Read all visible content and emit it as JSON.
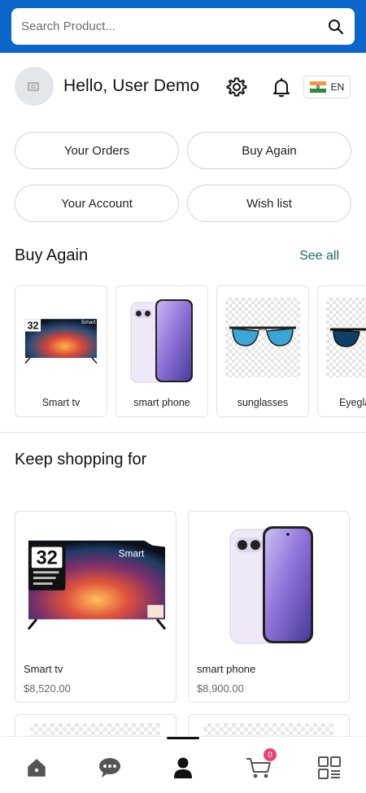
{
  "search": {
    "placeholder": "Search Product..."
  },
  "header": {
    "greeting": "Hello, User Demo",
    "language": "EN"
  },
  "quick_links": [
    "Your Orders",
    "Buy Again",
    "Your Account",
    "Wish list"
  ],
  "buy_again": {
    "title": "Buy Again",
    "see_all": "See all",
    "items": [
      {
        "label": "Smart tv"
      },
      {
        "label": "smart phone"
      },
      {
        "label": "sunglasses"
      },
      {
        "label": "Eyeglasses"
      }
    ]
  },
  "keep_shopping": {
    "title": "Keep shopping for",
    "items": [
      {
        "name": "Smart tv",
        "price": "$8,520.00"
      },
      {
        "name": "smart phone",
        "price": "$8,900.00"
      }
    ]
  },
  "tv_screen": {
    "size": "32",
    "brand": "Smart"
  },
  "cart_badge": "0",
  "colors": {
    "top_bar": "#0a66c8",
    "see_all": "#1d6b5a",
    "badge": "#e8407a"
  }
}
